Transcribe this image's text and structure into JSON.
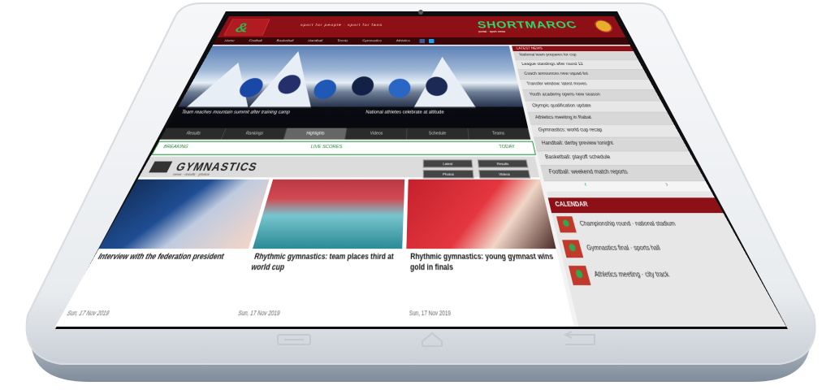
{
  "site": {
    "brand": "SHORTMAROC",
    "tagline": "sport for people · sport for fans",
    "brand_sub": "portal · sport news",
    "nav": [
      "Home",
      "Football",
      "Basketball",
      "Handball",
      "Tennis",
      "Gymnastics",
      "Athletics"
    ]
  },
  "hero": {
    "caption_left": "Team reaches mountain summit after training camp",
    "caption_right": "National athletes celebrate at altitude",
    "tabs": [
      "Results",
      "Rankings",
      "Highlights",
      "Videos",
      "Schedule",
      "Teams"
    ],
    "ticker": [
      "BREAKING",
      "LIVE SCORES",
      "TODAY"
    ]
  },
  "sidebar": {
    "header": "LATEST NEWS",
    "items": [
      "National team prepares for cup",
      "League standings after round 12",
      "Coach announces new squad list",
      "Transfer window: latest moves",
      "Youth academy opens new season",
      "Olympic qualification update",
      "Athletics meeting in Rabat",
      "Gymnastics: world cup recap",
      "Handball: derby preview tonight",
      "Basketball: playoff schedule",
      "Football: weekend match reports"
    ],
    "nav_prev": "‹",
    "nav_next": "›",
    "calendar_header": "CALENDAR",
    "calendar": [
      "Championship round · national stadium",
      "Gymnastics final · sports hall",
      "Athletics meeting · city track"
    ]
  },
  "section": {
    "title": "GYMNASTICS",
    "subtitle": "news · results · photos",
    "buttons": [
      "Latest",
      "Results",
      "Photos",
      "Videos"
    ],
    "cards": [
      {
        "title": "Interview with the federation president",
        "date": "Sun, 17 Nov 2019"
      },
      {
        "title": "Rhythmic gymnastics: team places third at world cup",
        "date": "Sun, 17 Nov 2019"
      },
      {
        "title": "Rhythmic gymnastics: young gymnast wins gold in finals",
        "date": "Sun, 17 Nov 2019"
      }
    ]
  },
  "colors": {
    "brand_red": "#8e1017",
    "accent_green": "#2da24b"
  }
}
